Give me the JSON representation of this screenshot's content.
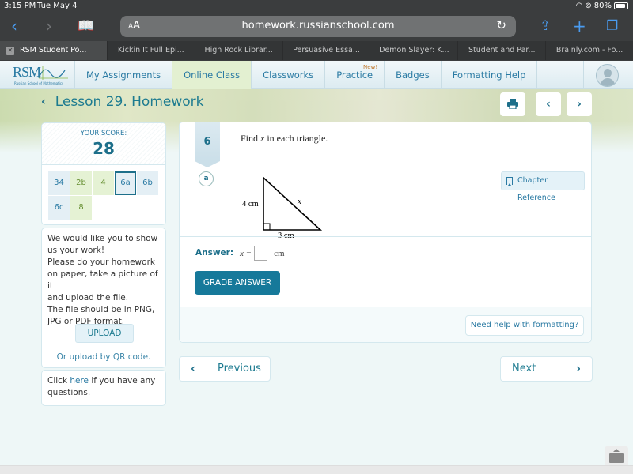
{
  "status_bar": {
    "time": "3:15 PM",
    "date": "Tue May 4",
    "battery": "80%"
  },
  "browser": {
    "text_size_label": "AA",
    "url": "homework.russianschool.com",
    "tabs": [
      {
        "label": "RSM Student Po...",
        "active": true
      },
      {
        "label": "Kickin It Full Epi...",
        "active": false
      },
      {
        "label": "High Rock Librar...",
        "active": false
      },
      {
        "label": "Persuasive Essa...",
        "active": false
      },
      {
        "label": "Demon Slayer: K...",
        "active": false
      },
      {
        "label": "Student and Par...",
        "active": false
      },
      {
        "label": "Brainly.com - Fo...",
        "active": false
      }
    ]
  },
  "site_nav": {
    "logo_text": "RSM",
    "logo_subtitle": "Russian School of Mathematics",
    "items": [
      {
        "label": "My Assignments",
        "active": false
      },
      {
        "label": "Online Class",
        "active": true
      },
      {
        "label": "Classworks",
        "active": false
      },
      {
        "label": "Practice",
        "active": false,
        "badge": "New!"
      },
      {
        "label": "Badges",
        "active": false
      },
      {
        "label": "Formatting Help",
        "active": false
      }
    ]
  },
  "lesson": {
    "title": "Lesson 29. Homework"
  },
  "score": {
    "label": "YOUR SCORE:",
    "value": "28"
  },
  "questions": [
    {
      "label": "34",
      "status": "pending"
    },
    {
      "label": "2b",
      "status": "done"
    },
    {
      "label": "4",
      "status": "done"
    },
    {
      "label": "6a",
      "status": "current"
    },
    {
      "label": "6b",
      "status": "pending"
    },
    {
      "label": "6c",
      "status": "pending"
    },
    {
      "label": "8",
      "status": "done"
    }
  ],
  "upload": {
    "message_lines": [
      "We would like you to show",
      "us your work!",
      "Please do your homework",
      "on paper, take a picture of it",
      "and upload the file.",
      "The file should be in PNG,",
      "JPG or PDF format."
    ],
    "button_label": "UPLOAD",
    "qr_link": "Or upload by QR code."
  },
  "help": {
    "prefix": "Click ",
    "link": "here",
    "suffix": " if you have any questions."
  },
  "problem": {
    "number": "6",
    "prompt_before": "Find ",
    "prompt_var": "x",
    "prompt_after": " in each triangle.",
    "part": "a",
    "chapter_reference_label": "Chapter Reference",
    "figure": {
      "left_side": "4 cm",
      "bottom_side": "3 cm",
      "hypotenuse": "x"
    },
    "answer_label": "Answer:",
    "answer_var": "x =",
    "answer_value": "",
    "answer_unit": "cm",
    "grade_button": "GRADE ANSWER",
    "format_help": "Need help with formatting?"
  },
  "pager": {
    "previous": "Previous",
    "next": "Next"
  }
}
